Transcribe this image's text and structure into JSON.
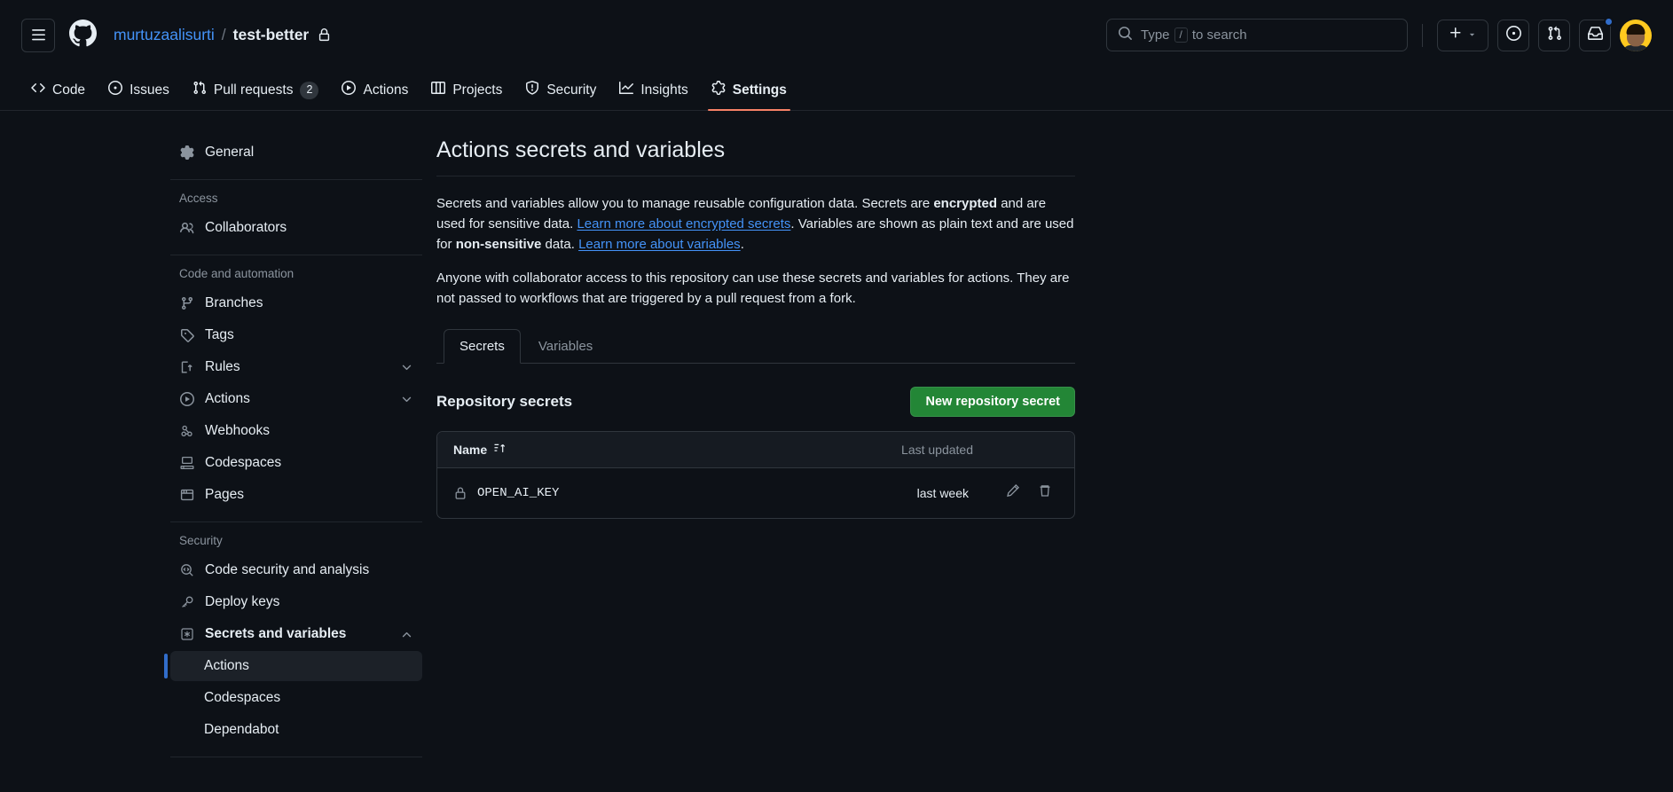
{
  "header": {
    "menu_icon": "hamburger-icon",
    "logo_icon": "github-logo-icon",
    "owner": "murtuzaalisurti",
    "separator": "/",
    "repo": "test-better",
    "visibility_icon": "lock-icon",
    "search_placeholder_prefix": "Type",
    "search_key": "/",
    "search_placeholder_suffix": "to search",
    "create_new_icon": "plus-icon",
    "create_new_caret_icon": "triangle-down-icon",
    "issues_icon": "issue-opened-icon",
    "pull_requests_icon": "git-pull-request-icon",
    "inbox_icon": "inbox-icon",
    "avatar_icon": "user-avatar"
  },
  "reponav": {
    "items": [
      {
        "label": "Code",
        "icon": "code-icon",
        "count": null,
        "active": false
      },
      {
        "label": "Issues",
        "icon": "issue-opened-icon",
        "count": null,
        "active": false
      },
      {
        "label": "Pull requests",
        "icon": "git-pull-request-icon",
        "count": "2",
        "active": false
      },
      {
        "label": "Actions",
        "icon": "play-circle-icon",
        "count": null,
        "active": false
      },
      {
        "label": "Projects",
        "icon": "table-icon",
        "count": null,
        "active": false
      },
      {
        "label": "Security",
        "icon": "shield-icon",
        "count": null,
        "active": false
      },
      {
        "label": "Insights",
        "icon": "graph-icon",
        "count": null,
        "active": false
      },
      {
        "label": "Settings",
        "icon": "gear-icon",
        "count": null,
        "active": true
      }
    ]
  },
  "sidebar": {
    "general": {
      "label": "General",
      "icon": "gear-icon"
    },
    "groups": [
      {
        "heading": "Access",
        "items": [
          {
            "label": "Collaborators",
            "icon": "people-icon",
            "chevron": null
          }
        ]
      },
      {
        "heading": "Code and automation",
        "items": [
          {
            "label": "Branches",
            "icon": "git-branch-icon",
            "chevron": null
          },
          {
            "label": "Tags",
            "icon": "tag-icon",
            "chevron": null
          },
          {
            "label": "Rules",
            "icon": "rules-icon",
            "chevron": "chevron-down-icon"
          },
          {
            "label": "Actions",
            "icon": "play-circle-icon",
            "chevron": "chevron-down-icon"
          },
          {
            "label": "Webhooks",
            "icon": "webhook-icon",
            "chevron": null
          },
          {
            "label": "Codespaces",
            "icon": "codespaces-icon",
            "chevron": null
          },
          {
            "label": "Pages",
            "icon": "browser-icon",
            "chevron": null
          }
        ]
      },
      {
        "heading": "Security",
        "items": [
          {
            "label": "Code security and analysis",
            "icon": "code-search-icon",
            "chevron": null
          },
          {
            "label": "Deploy keys",
            "icon": "key-icon",
            "chevron": null
          },
          {
            "label": "Secrets and variables",
            "icon": "asterisk-key-icon",
            "chevron": "chevron-up-icon",
            "bold": true
          }
        ]
      }
    ],
    "secrets_subitems": [
      {
        "label": "Actions",
        "selected": true
      },
      {
        "label": "Codespaces",
        "selected": false
      },
      {
        "label": "Dependabot",
        "selected": false
      }
    ]
  },
  "main": {
    "title": "Actions secrets and variables",
    "paragraph1": {
      "part1": "Secrets and variables allow you to manage reusable configuration data. Secrets are ",
      "bold1": "encrypted",
      "part2": " and are used for sensitive data. ",
      "link1": "Learn more about encrypted secrets",
      "part3": ". Variables are shown as plain text and are used for ",
      "bold2": "non-sensitive",
      "part4": " data. ",
      "link2": "Learn more about variables",
      "part5": "."
    },
    "paragraph2": "Anyone with collaborator access to this repository can use these secrets and variables for actions. They are not passed to workflows that are triggered by a pull request from a fork.",
    "tabs": [
      {
        "label": "Secrets",
        "active": true
      },
      {
        "label": "Variables",
        "active": false
      }
    ],
    "section_title": "Repository secrets",
    "new_secret_button": "New repository secret",
    "table": {
      "columns": [
        "Name",
        "Last updated"
      ],
      "sort_icon": "sort-asc-icon",
      "rows": [
        {
          "name": "OPEN_AI_KEY",
          "icon": "lock-icon",
          "last_updated": "last week",
          "edit_icon": "pencil-icon",
          "delete_icon": "trash-icon"
        }
      ]
    }
  },
  "colors": {
    "background": "#0d1117",
    "accent_green": "#238636",
    "link_blue": "#4493f8",
    "active_tab_underline": "#f78166",
    "selected_marker": "#316dca",
    "border": "#30363d"
  }
}
